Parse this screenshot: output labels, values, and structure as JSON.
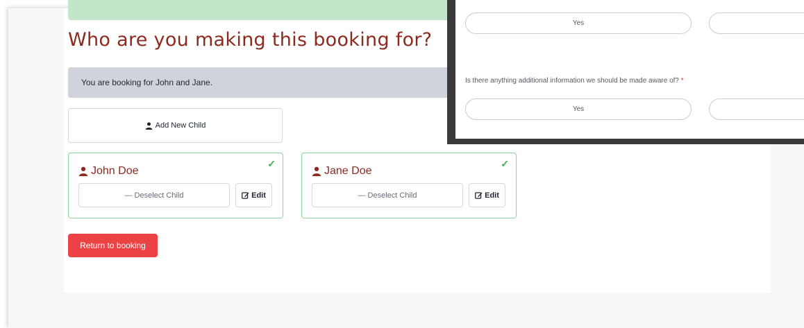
{
  "header": {
    "title": "Who are you making this booking for?"
  },
  "info": {
    "text": "You are booking for John and Jane."
  },
  "add_child": {
    "label": "Add New Child",
    "icon": "user-icon"
  },
  "children": [
    {
      "name": "John Doe",
      "selected": true,
      "deselect_label": "Deselect Child",
      "edit_label": "Edit"
    },
    {
      "name": "Jane Doe",
      "selected": true,
      "deselect_label": "Deselect Child",
      "edit_label": "Edit"
    }
  ],
  "actions": {
    "return_label": "Return to booking"
  },
  "overlay_form": {
    "q1_yes_label": "Yes",
    "question2": "Is there anything additional information we should be made aware of?",
    "required_marker": "*",
    "q2_yes_label": "Yes"
  },
  "colors": {
    "title": "#8c2a1e",
    "return_button": "#ec4245",
    "selected_border": "#8fd39a",
    "success_bar": "#c3e6cb",
    "info_bar": "#d0d4da"
  }
}
